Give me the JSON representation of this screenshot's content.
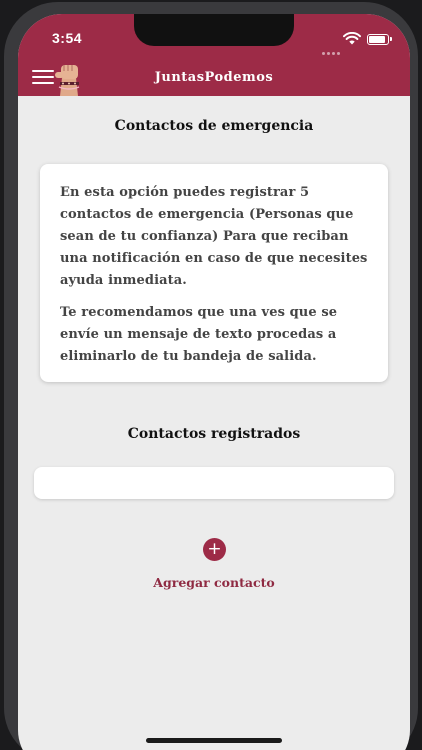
{
  "status_bar": {
    "time": "3:54"
  },
  "app_bar": {
    "title": "JuntasPodemos",
    "menu_icon": "hamburger-menu-icon",
    "logo_icon": "raised-fist-logo-icon"
  },
  "emergency": {
    "title": "Contactos de emergencia",
    "info_paragraph_1": "En esta opción puedes registrar 5 contactos de emergencia (Personas que sean de tu confianza) Para que reciban una notificación en caso de que necesites ayuda inmediata.",
    "info_paragraph_2": "Te recomendamos que una ves que se envíe un mensaje de texto procedas a eliminarlo de tu bandeja de salida."
  },
  "registered": {
    "title": "Contactos registrados",
    "items": []
  },
  "add_contact": {
    "icon": "plus-icon",
    "icon_glyph": "+",
    "label": "Agregar contacto"
  },
  "colors": {
    "primary": "#9d2b47",
    "background": "#ececec",
    "card": "#ffffff"
  }
}
